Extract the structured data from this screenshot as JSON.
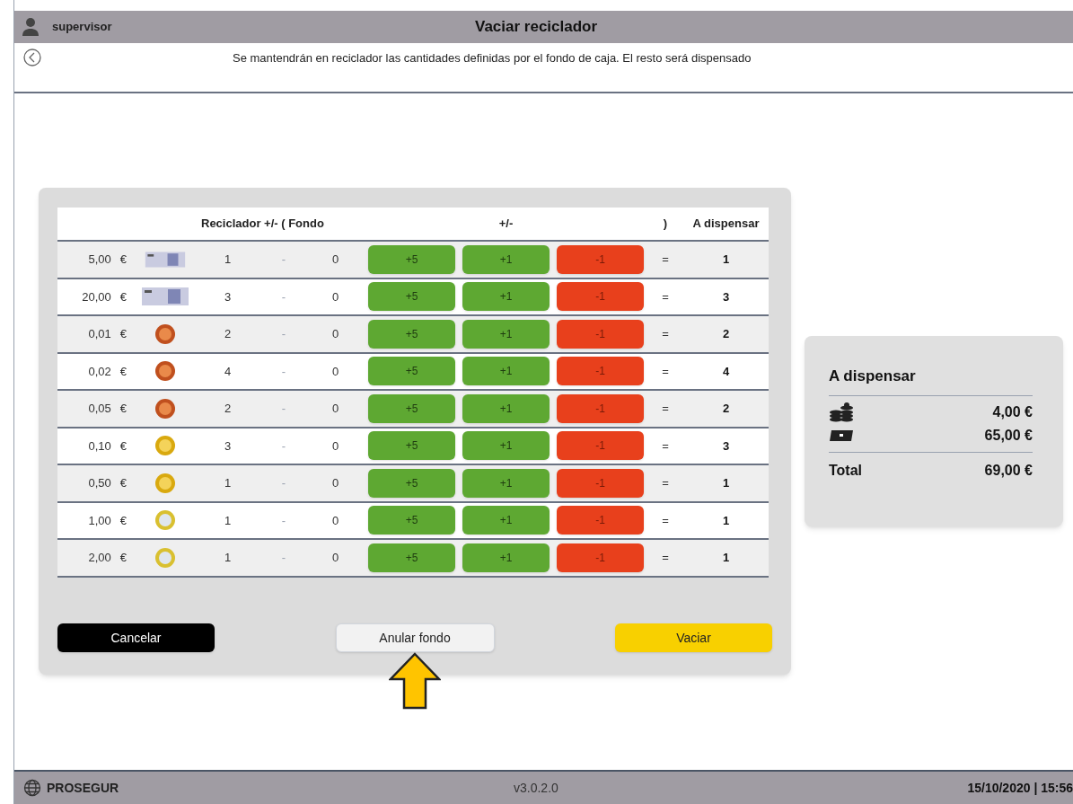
{
  "header": {
    "user": "supervisor",
    "title": "Vaciar reciclador"
  },
  "message": "Se mantendrán en reciclador las cantidades definidas por el fondo de caja. El resto será dispensado",
  "table": {
    "columns": [
      "Reciclador +/- ( Fondo",
      "+/-",
      ")",
      "A dispensar"
    ],
    "rows": [
      {
        "value": "5,00",
        "currency": "€",
        "kind": "note",
        "recycler": "1",
        "sep": "-",
        "fund": "0",
        "plus5": "+5",
        "plus1": "+1",
        "minus1": "-1",
        "eq": "=",
        "dispense": "1"
      },
      {
        "value": "20,00",
        "currency": "€",
        "kind": "note",
        "recycler": "3",
        "sep": "-",
        "fund": "0",
        "plus5": "+5",
        "plus1": "+1",
        "minus1": "-1",
        "eq": "=",
        "dispense": "3"
      },
      {
        "value": "0,01",
        "currency": "€",
        "kind": "copper",
        "recycler": "2",
        "sep": "-",
        "fund": "0",
        "plus5": "+5",
        "plus1": "+1",
        "minus1": "-1",
        "eq": "=",
        "dispense": "2"
      },
      {
        "value": "0,02",
        "currency": "€",
        "kind": "copper",
        "recycler": "4",
        "sep": "-",
        "fund": "0",
        "plus5": "+5",
        "plus1": "+1",
        "minus1": "-1",
        "eq": "=",
        "dispense": "4"
      },
      {
        "value": "0,05",
        "currency": "€",
        "kind": "copper",
        "recycler": "2",
        "sep": "-",
        "fund": "0",
        "plus5": "+5",
        "plus1": "+1",
        "minus1": "-1",
        "eq": "=",
        "dispense": "2"
      },
      {
        "value": "0,10",
        "currency": "€",
        "kind": "gold",
        "recycler": "3",
        "sep": "-",
        "fund": "0",
        "plus5": "+5",
        "plus1": "+1",
        "minus1": "-1",
        "eq": "=",
        "dispense": "3"
      },
      {
        "value": "0,50",
        "currency": "€",
        "kind": "gold",
        "recycler": "1",
        "sep": "-",
        "fund": "0",
        "plus5": "+5",
        "plus1": "+1",
        "minus1": "-1",
        "eq": "=",
        "dispense": "1"
      },
      {
        "value": "1,00",
        "currency": "€",
        "kind": "bimetal",
        "recycler": "1",
        "sep": "-",
        "fund": "0",
        "plus5": "+5",
        "plus1": "+1",
        "minus1": "-1",
        "eq": "=",
        "dispense": "1"
      },
      {
        "value": "2,00",
        "currency": "€",
        "kind": "bimetal",
        "recycler": "1",
        "sep": "-",
        "fund": "0",
        "plus5": "+5",
        "plus1": "+1",
        "minus1": "-1",
        "eq": "=",
        "dispense": "1"
      }
    ]
  },
  "buttons": {
    "cancel": "Cancelar",
    "reset": "Anular fondo",
    "empty": "Vaciar"
  },
  "summary": {
    "title": "A dispensar",
    "coins": "4,00 €",
    "notes": "65,00 €",
    "total_label": "Total",
    "total": "69,00 €"
  },
  "footer": {
    "brand": "PROSEGUR",
    "version": "v3.0.2.0",
    "datetime": "15/10/2020 | 15:56"
  }
}
